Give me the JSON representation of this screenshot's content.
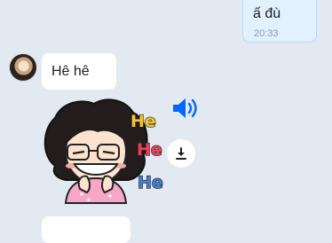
{
  "outgoing_message": {
    "text": "ấ đù",
    "time": "20:33"
  },
  "incoming_message": {
    "text": "Hê hê"
  },
  "sticker": {
    "words": [
      "He",
      "He",
      "He"
    ],
    "colors": [
      "#f5c431",
      "#e9405a",
      "#3f7fd6"
    ]
  },
  "icons": {
    "sound": "speaker-icon",
    "download": "download-icon"
  },
  "colors": {
    "accent": "#0068ff",
    "background": "#e2e9f1",
    "outgoing_bubble": "#e3f1ff"
  }
}
